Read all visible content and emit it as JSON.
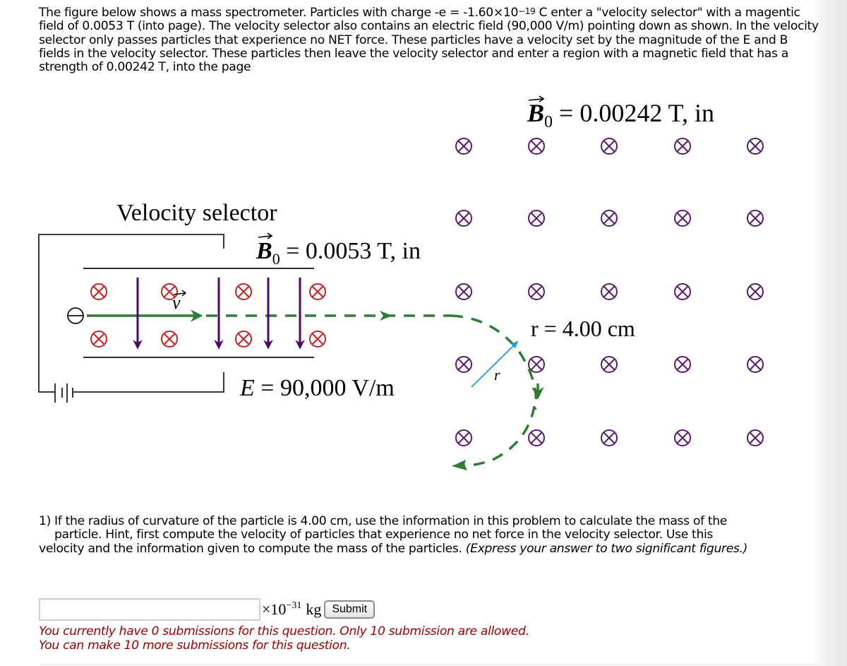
{
  "intro": {
    "part1": "The figure below shows a mass spectrometer.  Particles with charge -e = -1.60×10",
    "exponent": "−19",
    "part2": " C enter a \"velocity selector\" with a magentic field of 0.0053 T (into page).  The velocity selector also contains an electric field (90,000 V/m) pointing down as shown.  In the velocity selector only passes particles that experience no NET force.  These particles have a velocity set by the magnitude of the E and B fields in the velocity selector.  These particles then leave the velocity selector and enter a region with a magnetic field that has a strength of 0.00242 T, into the page"
  },
  "figure": {
    "selector_title": "Velocity selector",
    "selector_field_symbol": "B",
    "selector_field_subscript": "0",
    "selector_field_value": " = 0.0053 T, in",
    "electric_field_label": "E",
    "electric_field_value": " = 90,000 V/m",
    "velocity_label": "v",
    "region_field_symbol": "B",
    "region_field_subscript": "0",
    "region_field_value": " = 0.00242 T, in",
    "radius_label": "r = 4.00 cm",
    "radius_arrow_label": "r",
    "particle_symbol": "⊖",
    "colors": {
      "selector_markers": "#cc2222",
      "region_markers": "#5a1a6e",
      "e_field_arrows": "#4b0a6b",
      "trajectory": "#2e7d32",
      "radius_arrow": "#1e9be0"
    }
  },
  "question": {
    "line1": "1) If the radius of curvature of the particle is 4.00 cm, use the information in this problem to calculate the mass of the",
    "line2": "particle.  Hint, first compute the velocity of particles that experience no net force in the velocity selector.  Use this",
    "line3": "velocity and the information given to compute the mass of the particles.  ",
    "instruction": "(Express your answer to two significant figures.)"
  },
  "answer": {
    "value": "",
    "placeholder": "",
    "unit_prefix": "×10",
    "unit_exponent": "−31",
    "unit": "kg",
    "submit_label": "Submit"
  },
  "status": {
    "line1": "You currently have 0 submissions for this question. Only 10 submission are allowed.",
    "line2": "You can make 10 more submissions for this question."
  }
}
